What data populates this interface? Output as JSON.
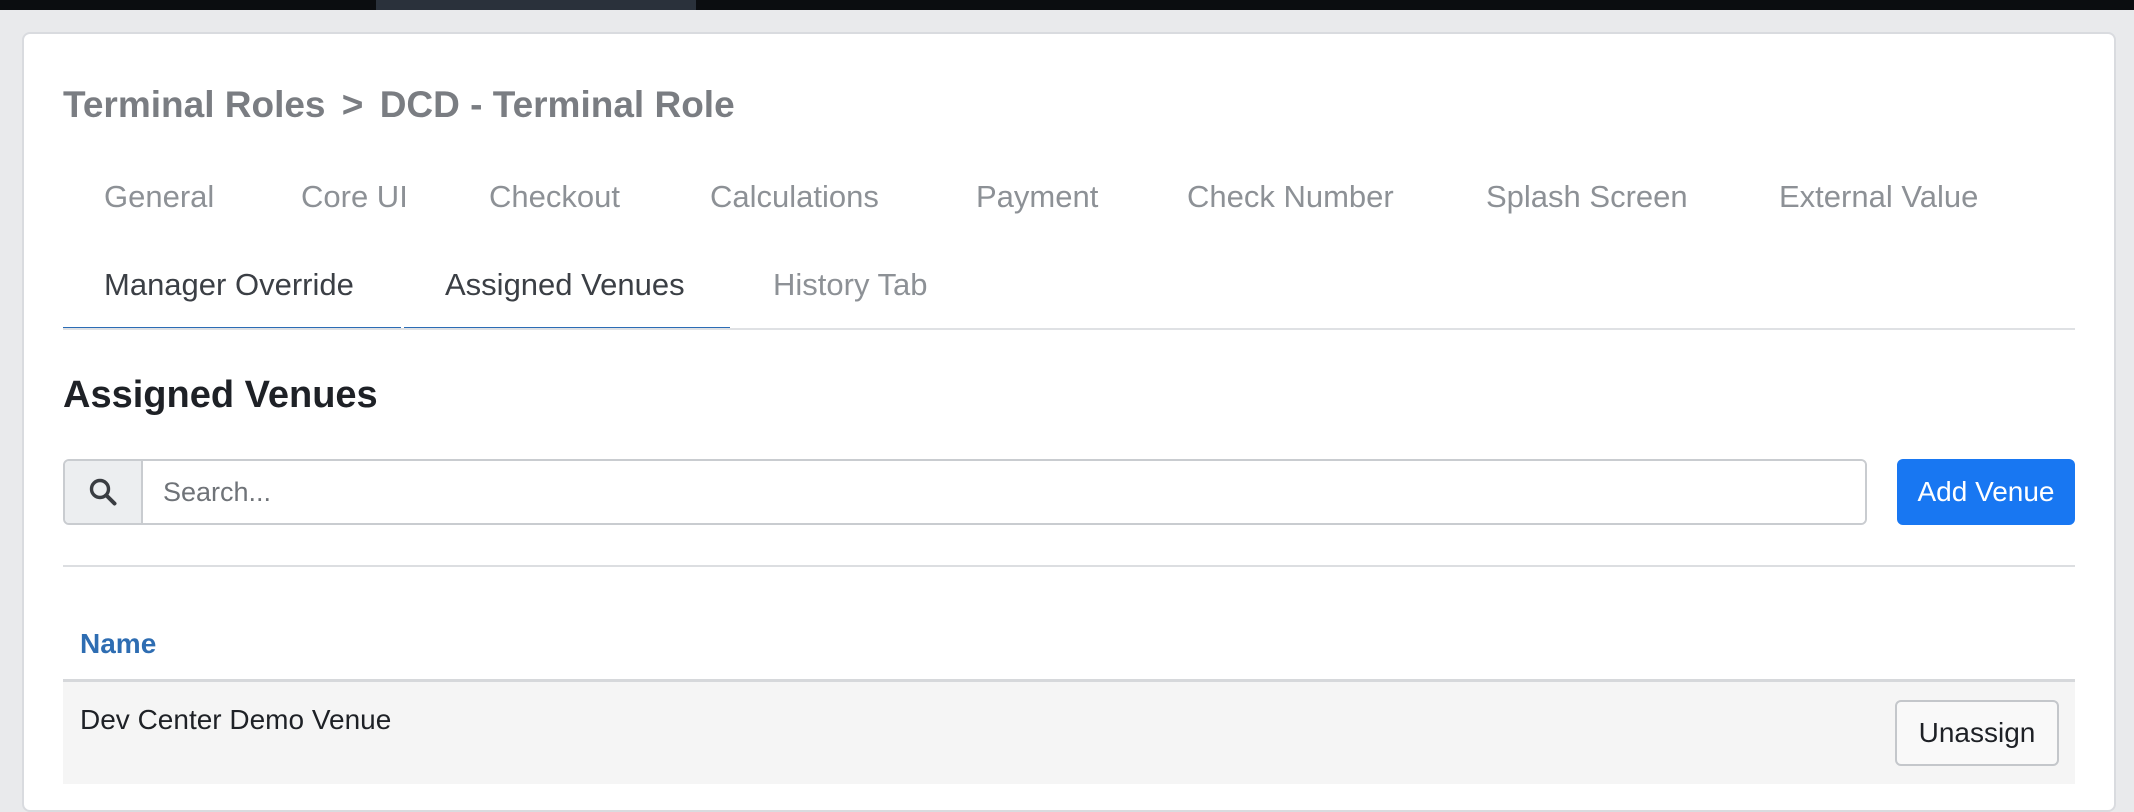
{
  "breadcrumb": {
    "parent": "Terminal Roles",
    "separator": ">",
    "current": "DCD - Terminal Role"
  },
  "tabs": [
    {
      "label": "General"
    },
    {
      "label": "Core UI"
    },
    {
      "label": "Checkout"
    },
    {
      "label": "Calculations"
    },
    {
      "label": "Payment"
    },
    {
      "label": "Check Number"
    },
    {
      "label": "Splash Screen"
    },
    {
      "label": "External Value"
    },
    {
      "label": "Manager Override"
    },
    {
      "label": "Assigned Venues",
      "active": true
    },
    {
      "label": "History Tab"
    }
  ],
  "section": {
    "title": "Assigned Venues"
  },
  "search": {
    "placeholder": "Search...",
    "value": "",
    "icon": "search-icon"
  },
  "actions": {
    "add_venue_label": "Add Venue"
  },
  "table": {
    "columns": [
      "Name"
    ],
    "rows": [
      {
        "name": "Dev Center Demo Venue",
        "action_label": "Unassign"
      }
    ]
  },
  "colors": {
    "accent": "#1877f2",
    "tab_underline": "#2b6cb5",
    "header_link": "#2e6db2"
  }
}
